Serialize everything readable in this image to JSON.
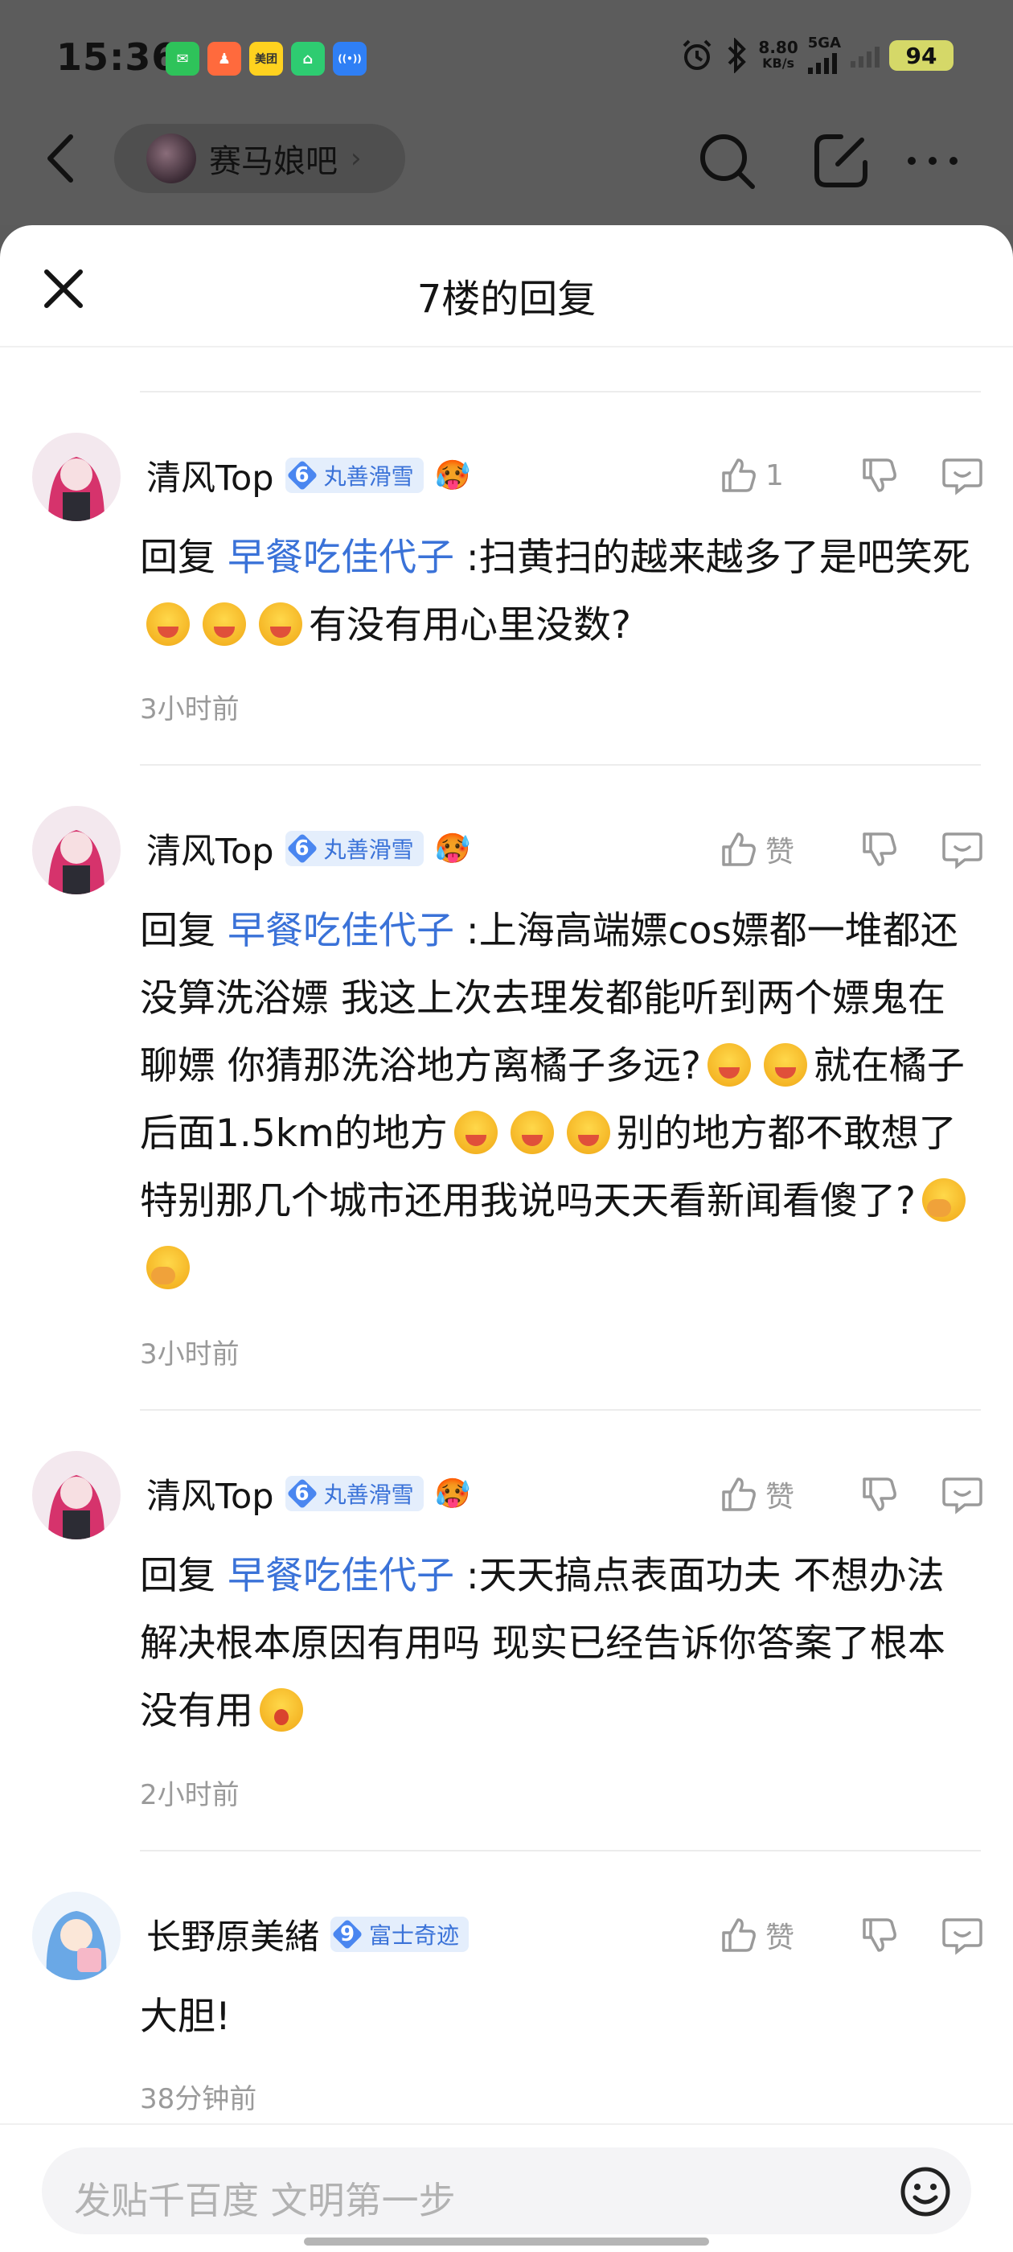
{
  "status_bar": {
    "time": "15:36",
    "app_icons": [
      {
        "name": "wechat-icon",
        "color": "#2ec35a",
        "glyph": "✉"
      },
      {
        "name": "dingdong-icon",
        "color": "#ff6a3d",
        "glyph": "♟"
      },
      {
        "name": "meituan-icon",
        "color": "#ffd21f",
        "glyph": "美团"
      },
      {
        "name": "home-app-icon",
        "color": "#2ecc71",
        "glyph": "⌂"
      },
      {
        "name": "hotspot-icon",
        "color": "#2f7ff5",
        "glyph": "((•))"
      }
    ],
    "net_speed": "8.80",
    "net_unit": "KB/s",
    "signal_label": "5GA",
    "battery": "94"
  },
  "nav": {
    "forum_name": "赛马娘吧"
  },
  "sheet": {
    "title": "7楼的回复"
  },
  "comments": [
    {
      "username": "清风Top",
      "level": "6",
      "badge": "丸善滑雪",
      "likes": "1",
      "reply_prefix": "回复",
      "mention": "早餐吃佳代子",
      "text_a": " :扫黄扫的越来越多了是吧笑死",
      "text_b": "有没有用心里没数?",
      "time": "3小时前"
    },
    {
      "username": "清风Top",
      "level": "6",
      "badge": "丸善滑雪",
      "likes": "赞",
      "reply_prefix": "回复",
      "mention": "早餐吃佳代子",
      "text_a": " :上海高端嫖cos嫖都一堆都还没算洗浴嫖 我这上次去理发都能听到两个嫖鬼在聊嫖 你猜那洗浴地方离橘子多远?",
      "text_b": "就在橘子后面1.5km的地方",
      "text_c": "别的地方都不敢想了 特别那几个城市还用我说吗天天看新闻看傻了?",
      "time": "3小时前"
    },
    {
      "username": "清风Top",
      "level": "6",
      "badge": "丸善滑雪",
      "likes": "赞",
      "reply_prefix": "回复",
      "mention": "早餐吃佳代子",
      "text_a": " :天天搞点表面功夫 不想办法解决根本原因有用吗 现实已经告诉你答案了根本没有用",
      "time": "2小时前"
    },
    {
      "username": "长野原美緒",
      "level": "9",
      "badge": "富士奇迹",
      "likes": "赞",
      "text_a": "大胆!",
      "time": "38分钟前"
    }
  ],
  "input": {
    "placeholder": "发贴千百度 文明第一步"
  }
}
